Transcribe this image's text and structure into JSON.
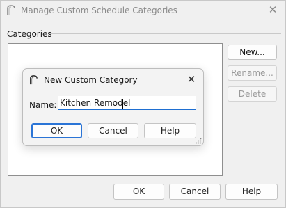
{
  "window": {
    "title": "Manage Custom Schedule Categories",
    "close_glyph": "✕"
  },
  "group": {
    "label": "Categories"
  },
  "side_buttons": {
    "new_label": "New...",
    "rename_label": "Rename...",
    "delete_label": "Delete"
  },
  "footer": {
    "ok_label": "OK",
    "cancel_label": "Cancel",
    "help_label": "Help"
  },
  "dialog": {
    "title": "New Custom Category",
    "close_glyph": "✕",
    "name_label": "Name:",
    "name_value": "Kitchen Remodel",
    "ok_label": "OK",
    "cancel_label": "Cancel",
    "help_label": "Help"
  },
  "colors": {
    "accent": "#1f6fd1",
    "window_bg": "#f0f0f0",
    "disabled_text": "#9a9a9a"
  },
  "icons": [
    "app-arch-icon",
    "close-icon",
    "resize-grip-icon"
  ]
}
